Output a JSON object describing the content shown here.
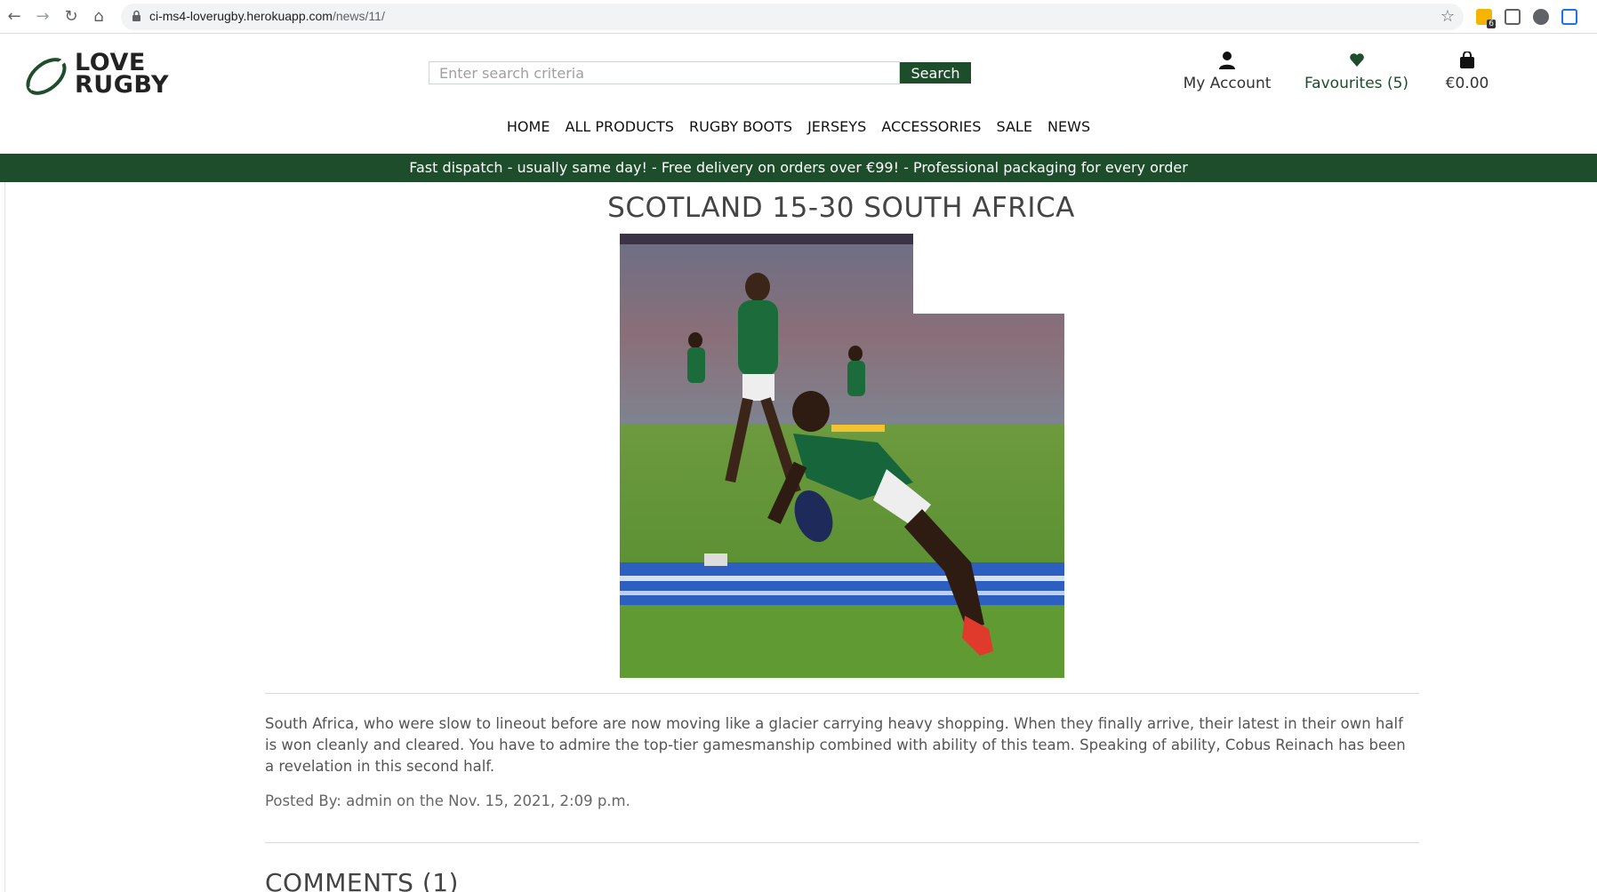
{
  "browser": {
    "url_domain": "ci-ms4-loverugby.herokuapp.com",
    "url_path": "/news/11/",
    "extension_badge": "6"
  },
  "header": {
    "logo_line1": "LOVE",
    "logo_line2": "RUGBY",
    "search_placeholder": "Enter search criteria",
    "search_button": "Search",
    "account_label": "My Account",
    "favourites_label": "Favourites (5)",
    "bag_total": "€0.00"
  },
  "nav": {
    "items": [
      "HOME",
      "ALL PRODUCTS",
      "RUGBY BOOTS",
      "JERSEYS",
      "ACCESSORIES",
      "SALE",
      "NEWS"
    ]
  },
  "banner": {
    "text": "Fast dispatch - usually same day! - Free delivery on orders over €99! - Professional packaging for every order"
  },
  "article": {
    "title": "SCOTLAND 15-30 SOUTH AFRICA",
    "body": "South Africa, who were slow to lineout before are now moving like a glacier carrying heavy shopping. When they finally arrive, their latest in their own half is won cleanly and cleared. You have to admire the top-tier gamesmanship combined with ability of this team. Speaking of ability, Cobus Reinach has been a revelation in this second half.",
    "posted_by": "Posted By: admin on the Nov. 15, 2021, 2:09 p.m.",
    "comments_heading": "COMMENTS (1)"
  },
  "colors": {
    "brand_green": "#1e4d2b",
    "text_dark": "#333333"
  }
}
